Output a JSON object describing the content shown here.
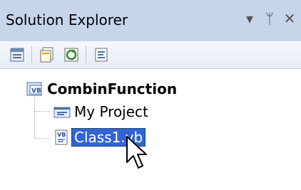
{
  "window": {
    "title": "Solution Explorer",
    "controls": {
      "dropdown": "▾",
      "pin": "ᛘ",
      "close": "✕"
    }
  },
  "toolbar": {
    "buttons": [
      {
        "icon": "properties-icon"
      },
      {
        "icon": "show-all-files-icon"
      },
      {
        "icon": "refresh-icon"
      },
      {
        "icon": "view-code-icon"
      }
    ]
  },
  "tree": {
    "root": {
      "label": "CombinFunction",
      "icon": "vb-project-icon"
    },
    "children": [
      {
        "label": "My Project",
        "icon": "my-project-icon",
        "selected": false
      },
      {
        "label": "Class1.vb",
        "icon": "vb-file-icon",
        "selected": true
      }
    ]
  },
  "colors": {
    "titlebar": "#c7d5ea",
    "selection": "#3165d3"
  }
}
